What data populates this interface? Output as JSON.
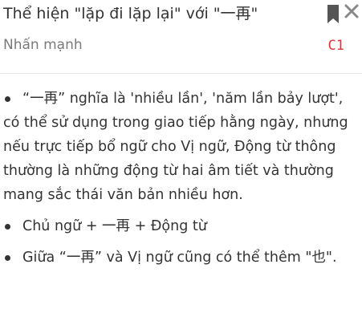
{
  "header": {
    "title": "Thể hiện \"lặp đi lặp lại\" với \"一再\"",
    "subtitle": "Nhấn mạnh",
    "level": "C1",
    "level_color": "#e0323c"
  },
  "icons": {
    "bookmark": "bookmark-icon",
    "close": "close-icon"
  },
  "bullets": [
    "“一再” nghĩa là 'nhiều lần', 'năm lần bảy lượt', có thể sử dụng trong giao tiếp hằng ngày, nhưng nếu trực tiếp bổ ngữ cho Vị ngữ, Động từ thông thường là những động từ hai âm tiết và thường mang sắc thái văn bản nhiều hơn.",
    "Chủ ngữ + 一再 + Động từ",
    "Giữa “一再” và Vị ngữ cũng có thể thêm \"也\"."
  ]
}
